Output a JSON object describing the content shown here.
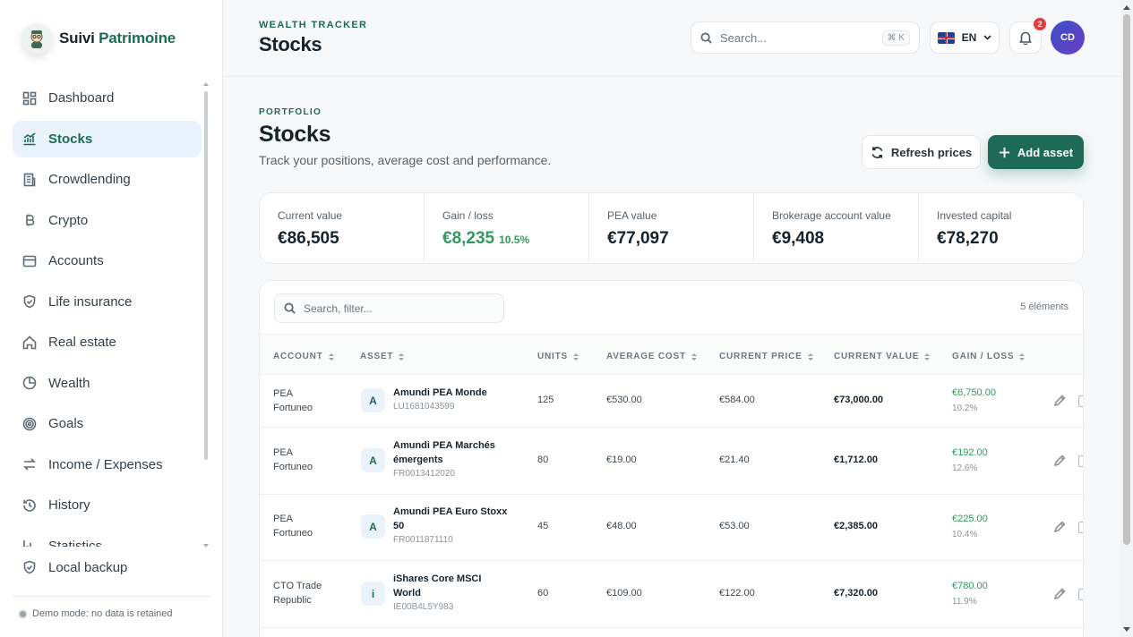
{
  "brand": {
    "name_part1": "Suivi",
    "name_part2": "Patrimoine"
  },
  "sidebar": {
    "items": [
      {
        "label": "Dashboard",
        "icon": "dashboard-icon"
      },
      {
        "label": "Stocks",
        "icon": "chart-icon",
        "active": true
      },
      {
        "label": "Crowdlending",
        "icon": "building-icon"
      },
      {
        "label": "Crypto",
        "icon": "bitcoin-icon"
      },
      {
        "label": "Accounts",
        "icon": "wallet-icon"
      },
      {
        "label": "Life insurance",
        "icon": "shield-icon"
      },
      {
        "label": "Real estate",
        "icon": "home-icon"
      },
      {
        "label": "Wealth",
        "icon": "pie-icon"
      },
      {
        "label": "Goals",
        "icon": "target-icon"
      },
      {
        "label": "Income / Expenses",
        "icon": "arrows-icon"
      },
      {
        "label": "History",
        "icon": "history-icon"
      },
      {
        "label": "Statistics",
        "icon": "bar-chart-icon"
      }
    ],
    "backup_label": "Local backup",
    "demo_text": "Demo mode: no data is retained"
  },
  "header": {
    "eyebrow": "WEALTH TRACKER",
    "title": "Stocks",
    "search_placeholder": "Search...",
    "search_shortcut": "⌘ K",
    "language": "EN",
    "notification_count": "2",
    "avatar_initials": "CD"
  },
  "page": {
    "eyebrow": "PORTFOLIO",
    "title": "Stocks",
    "subtitle": "Track your positions, average cost and performance.",
    "refresh_label": "Refresh prices",
    "add_label": "Add asset"
  },
  "stats": [
    {
      "label": "Current value",
      "value": "€86,505"
    },
    {
      "label": "Gain / loss",
      "value": "€8,235",
      "pct": "10.5%"
    },
    {
      "label": "PEA value",
      "value": "€77,097"
    },
    {
      "label": "Brokerage account value",
      "value": "€9,408"
    },
    {
      "label": "Invested capital",
      "value": "€78,270"
    }
  ],
  "table": {
    "filter_placeholder": "Search, filter...",
    "count": "5 éléments",
    "headers": {
      "account": "ACCOUNT",
      "asset": "ASSET",
      "units": "UNITS",
      "avg_cost": "AVERAGE COST",
      "current_price": "CURRENT PRICE",
      "current_value": "CURRENT VALUE",
      "gain": "GAIN / LOSS"
    },
    "rows": [
      {
        "account1": "PEA",
        "account2": "Fortuneo",
        "initial": "A",
        "name1": "Amundi PEA Monde",
        "name2": "",
        "isin": "LU1681043599",
        "units": "125",
        "avg": "€530.00",
        "price": "€584.00",
        "value": "€73,000.00",
        "gain": "€6,750.00",
        "gain_pct": "10.2%"
      },
      {
        "account1": "PEA",
        "account2": "Fortuneo",
        "initial": "A",
        "name1": "Amundi PEA Marchés",
        "name2": "émergents",
        "isin": "FR0013412020",
        "units": "80",
        "avg": "€19.00",
        "price": "€21.40",
        "value": "€1,712.00",
        "gain": "€192.00",
        "gain_pct": "12.6%"
      },
      {
        "account1": "PEA",
        "account2": "Fortuneo",
        "initial": "A",
        "name1": "Amundi PEA Euro Stoxx",
        "name2": "50",
        "isin": "FR0011871110",
        "units": "45",
        "avg": "€48.00",
        "price": "€53.00",
        "value": "€2,385.00",
        "gain": "€225.00",
        "gain_pct": "10.4%"
      },
      {
        "account1": "CTO Trade",
        "account2": "Republic",
        "initial": "i",
        "name1": "iShares Core MSCI",
        "name2": "World",
        "isin": "IE00B4L5Y983",
        "units": "60",
        "avg": "€109.00",
        "price": "€122.00",
        "value": "€7,320.00",
        "gain": "€780.00",
        "gain_pct": "11.9%"
      }
    ]
  }
}
